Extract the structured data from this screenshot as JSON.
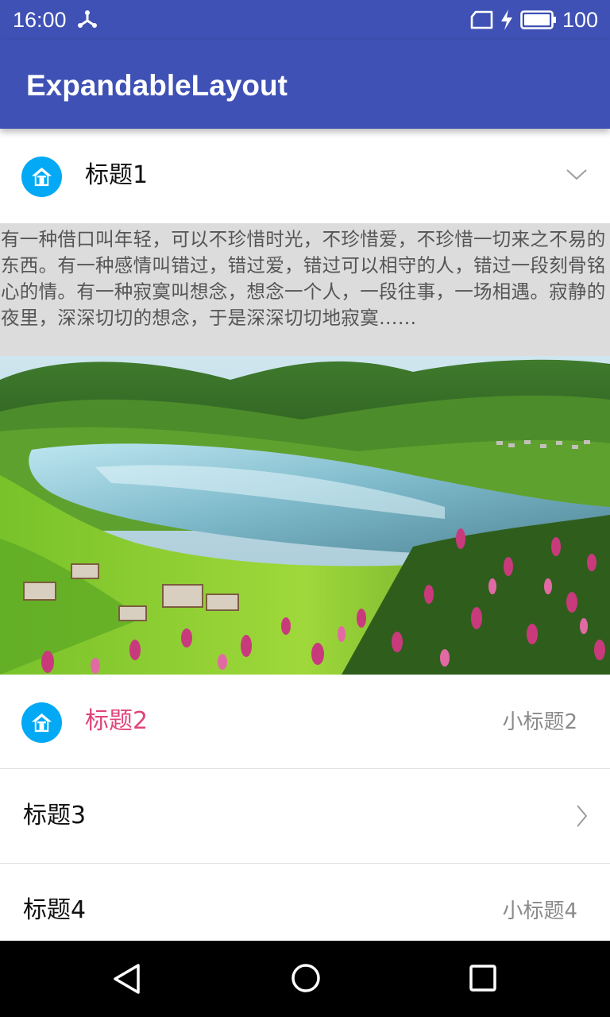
{
  "status_bar": {
    "time": "16:00",
    "battery_level": "100",
    "icons": [
      "usb-icon",
      "sim-card-icon",
      "charging-icon",
      "battery-icon"
    ],
    "background_color": "#3f51b5"
  },
  "app_bar": {
    "title": "ExpandableLayout",
    "background_color": "#3f51b5"
  },
  "list": {
    "items": [
      {
        "title": "标题1",
        "icon": "home-icon",
        "indicator": "chevron-down-icon",
        "expanded": true,
        "content_text": "有一种借口叫年轻，可以不珍惜时光，不珍惜爱，不珍惜一切来之不易的东西。有一种感情叫错过，错过爱，错过可以相守的人，错过一段刻骨铭心的情。有一种寂寞叫想念，想念一个人，一段往事，一场相遇。寂静的夜里，深深切切的想念，于是深深切切地寂寞……",
        "content_image": "landscape-lake-photo"
      },
      {
        "title": "标题2",
        "subtitle": "小标题2",
        "icon": "home-icon",
        "title_color": "#e0457b"
      },
      {
        "title": "标题3",
        "indicator": "chevron-right-icon"
      },
      {
        "title": "标题4",
        "subtitle": "小标题4"
      }
    ],
    "icon_color": "#03a9f4"
  },
  "nav_bar": {
    "buttons": [
      "back-icon",
      "home-circle-icon",
      "recent-apps-icon"
    ]
  }
}
